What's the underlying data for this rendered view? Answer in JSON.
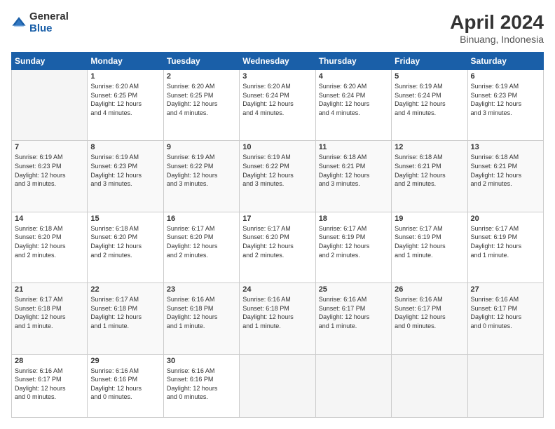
{
  "header": {
    "logo_general": "General",
    "logo_blue": "Blue",
    "title": "April 2024",
    "location": "Binuang, Indonesia"
  },
  "weekdays": [
    "Sunday",
    "Monday",
    "Tuesday",
    "Wednesday",
    "Thursday",
    "Friday",
    "Saturday"
  ],
  "weeks": [
    [
      {
        "day": "",
        "info": ""
      },
      {
        "day": "1",
        "info": "Sunrise: 6:20 AM\nSunset: 6:25 PM\nDaylight: 12 hours\nand 4 minutes."
      },
      {
        "day": "2",
        "info": "Sunrise: 6:20 AM\nSunset: 6:25 PM\nDaylight: 12 hours\nand 4 minutes."
      },
      {
        "day": "3",
        "info": "Sunrise: 6:20 AM\nSunset: 6:24 PM\nDaylight: 12 hours\nand 4 minutes."
      },
      {
        "day": "4",
        "info": "Sunrise: 6:20 AM\nSunset: 6:24 PM\nDaylight: 12 hours\nand 4 minutes."
      },
      {
        "day": "5",
        "info": "Sunrise: 6:19 AM\nSunset: 6:24 PM\nDaylight: 12 hours\nand 4 minutes."
      },
      {
        "day": "6",
        "info": "Sunrise: 6:19 AM\nSunset: 6:23 PM\nDaylight: 12 hours\nand 3 minutes."
      }
    ],
    [
      {
        "day": "7",
        "info": "Sunrise: 6:19 AM\nSunset: 6:23 PM\nDaylight: 12 hours\nand 3 minutes."
      },
      {
        "day": "8",
        "info": "Sunrise: 6:19 AM\nSunset: 6:23 PM\nDaylight: 12 hours\nand 3 minutes."
      },
      {
        "day": "9",
        "info": "Sunrise: 6:19 AM\nSunset: 6:22 PM\nDaylight: 12 hours\nand 3 minutes."
      },
      {
        "day": "10",
        "info": "Sunrise: 6:19 AM\nSunset: 6:22 PM\nDaylight: 12 hours\nand 3 minutes."
      },
      {
        "day": "11",
        "info": "Sunrise: 6:18 AM\nSunset: 6:21 PM\nDaylight: 12 hours\nand 3 minutes."
      },
      {
        "day": "12",
        "info": "Sunrise: 6:18 AM\nSunset: 6:21 PM\nDaylight: 12 hours\nand 2 minutes."
      },
      {
        "day": "13",
        "info": "Sunrise: 6:18 AM\nSunset: 6:21 PM\nDaylight: 12 hours\nand 2 minutes."
      }
    ],
    [
      {
        "day": "14",
        "info": "Sunrise: 6:18 AM\nSunset: 6:20 PM\nDaylight: 12 hours\nand 2 minutes."
      },
      {
        "day": "15",
        "info": "Sunrise: 6:18 AM\nSunset: 6:20 PM\nDaylight: 12 hours\nand 2 minutes."
      },
      {
        "day": "16",
        "info": "Sunrise: 6:17 AM\nSunset: 6:20 PM\nDaylight: 12 hours\nand 2 minutes."
      },
      {
        "day": "17",
        "info": "Sunrise: 6:17 AM\nSunset: 6:20 PM\nDaylight: 12 hours\nand 2 minutes."
      },
      {
        "day": "18",
        "info": "Sunrise: 6:17 AM\nSunset: 6:19 PM\nDaylight: 12 hours\nand 2 minutes."
      },
      {
        "day": "19",
        "info": "Sunrise: 6:17 AM\nSunset: 6:19 PM\nDaylight: 12 hours\nand 1 minute."
      },
      {
        "day": "20",
        "info": "Sunrise: 6:17 AM\nSunset: 6:19 PM\nDaylight: 12 hours\nand 1 minute."
      }
    ],
    [
      {
        "day": "21",
        "info": "Sunrise: 6:17 AM\nSunset: 6:18 PM\nDaylight: 12 hours\nand 1 minute."
      },
      {
        "day": "22",
        "info": "Sunrise: 6:17 AM\nSunset: 6:18 PM\nDaylight: 12 hours\nand 1 minute."
      },
      {
        "day": "23",
        "info": "Sunrise: 6:16 AM\nSunset: 6:18 PM\nDaylight: 12 hours\nand 1 minute."
      },
      {
        "day": "24",
        "info": "Sunrise: 6:16 AM\nSunset: 6:18 PM\nDaylight: 12 hours\nand 1 minute."
      },
      {
        "day": "25",
        "info": "Sunrise: 6:16 AM\nSunset: 6:17 PM\nDaylight: 12 hours\nand 1 minute."
      },
      {
        "day": "26",
        "info": "Sunrise: 6:16 AM\nSunset: 6:17 PM\nDaylight: 12 hours\nand 0 minutes."
      },
      {
        "day": "27",
        "info": "Sunrise: 6:16 AM\nSunset: 6:17 PM\nDaylight: 12 hours\nand 0 minutes."
      }
    ],
    [
      {
        "day": "28",
        "info": "Sunrise: 6:16 AM\nSunset: 6:17 PM\nDaylight: 12 hours\nand 0 minutes."
      },
      {
        "day": "29",
        "info": "Sunrise: 6:16 AM\nSunset: 6:16 PM\nDaylight: 12 hours\nand 0 minutes."
      },
      {
        "day": "30",
        "info": "Sunrise: 6:16 AM\nSunset: 6:16 PM\nDaylight: 12 hours\nand 0 minutes."
      },
      {
        "day": "",
        "info": ""
      },
      {
        "day": "",
        "info": ""
      },
      {
        "day": "",
        "info": ""
      },
      {
        "day": "",
        "info": ""
      }
    ]
  ]
}
